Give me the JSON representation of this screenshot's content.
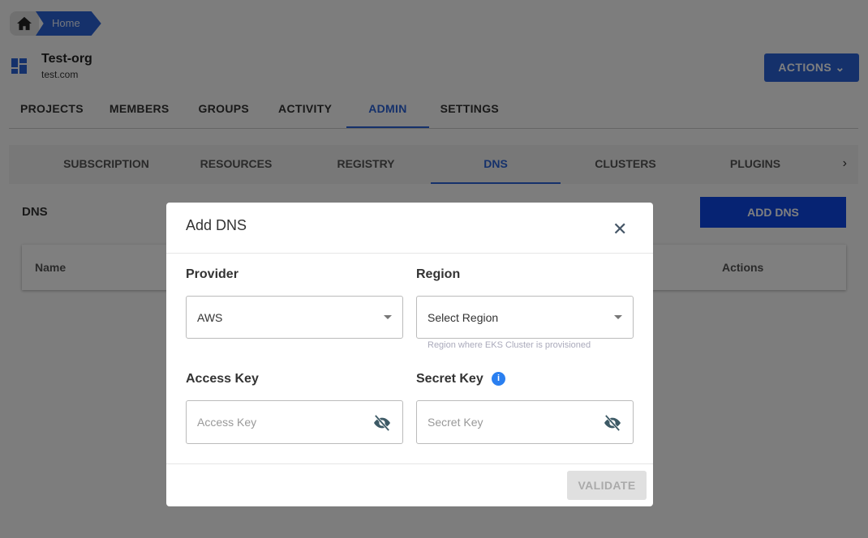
{
  "breadcrumb": {
    "home_icon": "home-icon",
    "items": [
      "Home"
    ]
  },
  "org": {
    "name": "Test-org",
    "domain": "test.com",
    "icon": "dashboard-icon"
  },
  "actions_label": "ACTIONS",
  "tabs": [
    "PROJECTS",
    "MEMBERS",
    "GROUPS",
    "ACTIVITY",
    "ADMIN",
    "SETTINGS"
  ],
  "active_tab": "ADMIN",
  "subtabs": [
    "SUBSCRIPTION",
    "RESOURCES",
    "REGISTRY",
    "DNS",
    "CLUSTERS",
    "PLUGINS"
  ],
  "active_subtab": "DNS",
  "section": {
    "title": "DNS",
    "add_label": "ADD DNS",
    "columns": [
      "Name",
      "Actions"
    ]
  },
  "modal": {
    "title": "Add DNS",
    "provider": {
      "label": "Provider",
      "value": "AWS"
    },
    "region": {
      "label": "Region",
      "placeholder": "Select Region",
      "helper": "Region where EKS Cluster is provisioned"
    },
    "access_key": {
      "label": "Access Key",
      "placeholder": "Access Key"
    },
    "secret_key": {
      "label": "Secret Key",
      "placeholder": "Secret Key",
      "info": "i"
    },
    "validate_label": "VALIDATE"
  },
  "colors": {
    "primary": "#2a62d6",
    "add_button": "#0d47e6"
  }
}
